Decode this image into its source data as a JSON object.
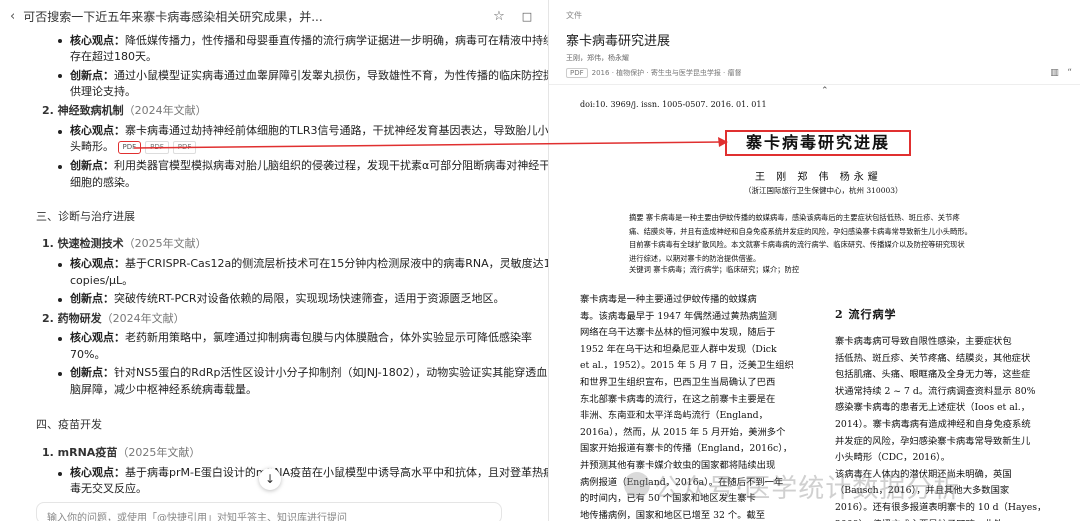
{
  "left": {
    "back_icon": "‹",
    "title": "可否搜索一下近五年来寨卡病毒感染相关研究成果，并...",
    "star_icon": "☆",
    "lock_icon": "🔒",
    "lines": {
      "l1a": "核心观点：",
      "l1b": "降低媒传播力，性传播和母婴垂直传播的流行病学证据进一步明确，病毒可在精液中持续",
      "l1c": "存在超过180天。",
      "l2a": "创新点：",
      "l2b": "通过小鼠模型证实病毒通过血睾屏障引发睾丸损伤，导致雄性不育，为性传播的临床防控提",
      "l2c": "供理论支持。",
      "s2": "2. 神经致病机制",
      "s2y": "（2024年文献）",
      "l3a": "核心观点：",
      "l3b": "寨卡病毒通过劫持神经前体细胞的TLR3信号通路，干扰神经发育基因表达，导致胎儿小",
      "l3c": "头畸形。",
      "l4a": "创新点：",
      "l4b": "利用类器官模型模拟病毒对胎儿脑组织的侵袭过程，发现干扰素α可部分阻断病毒对神经干",
      "l4c": "细胞的感染。",
      "h3": "三、诊断与治疗进展",
      "s3": "1. 快速检测技术",
      "s3y": "（2025年文献）",
      "l5a": "核心观点：",
      "l5b": "基于CRISPR-Cas12a的侧流层析技术可在15分钟内检测尿液中的病毒RNA，灵敏度达10",
      "l5c": "copies/μL。",
      "l6a": "创新点：",
      "l6b": "突破传统RT-PCR对设备依赖的局限，实现现场快速筛查，适用于资源匮乏地区。",
      "s4": "2. 药物研发",
      "s4y": "（2024年文献）",
      "l7a": "核心观点：",
      "l7b": "老药新用策略中，氯喹通过抑制病毒包膜与内体膜融合，体外实验显示可降低感染率",
      "l7c": "70%。",
      "l8a": "创新点：",
      "l8b": "针对NS5蛋白的RdRp活性区设计小分子抑制剂（如JNJ-1802），动物实验证实其能穿透血",
      "l8c": "脑屏障，减少中枢神经系统病毒载量。",
      "h4": "四、疫苗开发",
      "s5": "1. mRNA疫苗",
      "s5y": "（2025年文献）",
      "l9a": "核心观点：",
      "l9b": "基于病毒prM-E蛋白设计的mRNA疫苗在小鼠模型中诱导高水平中和抗体，且对登革热病",
      "l9c": "毒无交叉反应。"
    },
    "pdf_tags": [
      "PDF",
      "PDF",
      "PDF"
    ],
    "scroll_icon": "↓",
    "input_placeholder": "输入你的问题，或使用「@快捷引用」对知乎答主、知识库进行提问"
  },
  "right": {
    "file_label": "文件",
    "file_title": "寨卡病毒研究进展",
    "authors": "王刚，郑伟，杨永耀",
    "meta": {
      "tag": "PDF",
      "year": "2016",
      "journal": "· 植物保护 · 寄生虫与医学昆虫学报 · 瘤督"
    },
    "icons": [
      "▥",
      "“"
    ],
    "paper": {
      "doi": "doi:10. 3969/j. issn. 1005-0507. 2016. 01. 011",
      "title": "寨卡病毒研究进展",
      "authors": "王 刚 郑 伟 杨永耀",
      "affil": "（浙江国际旅行卫生保健中心，杭州 310003）",
      "abs1": "摘要  寨卡病毒是一种主要由伊蚊传播的蚊媒病毒，感染该病毒后的主要症状包括低热、斑丘疹、关节疼",
      "abs2": "痛、结膜炎等，并且有造成神经和自身免疫系统并发症的风险，孕妇感染寨卡病毒常导致新生儿小头畸形。",
      "abs3": "目前寨卡病毒有全球扩散风险。本文就寨卡病毒病的流行病学、临床研究、传播媒介以及防控等研究现状",
      "abs4": "进行综述，以期对寨卡的防治提供借鉴。",
      "keywords": "关键词  寨卡病毒；流行病学；临床研究；媒介；防控",
      "c1": [
        "寨卡病毒是一种主要通过伊蚊传播的蚊媒病",
        "毒。该病毒最早于 1947 年偶然通过黄热病监测",
        "网络在乌干达寨卡丛林的恒河猴中发现，随后于",
        "1952 年在乌干达和坦桑尼亚人群中发现（Dick",
        "et al.，1952）。2015 年 5 月 7 日，泛美卫生组织",
        "和世界卫生组织宣布，巴西卫生当局确认了巴西",
        "东北部寨卡病毒的流行，在这之前寨卡主要是在",
        "非洲、东南亚和太平洋岛屿流行（England，",
        "2016a），然而，从 2015 年 5 月开始，美洲多个",
        "国家开始报道有寨卡的传播（England，2016c），",
        "并预测其他有寨卡媒介蚊虫的国家都将陆续出现",
        "病例报道（England，2016a）。在随后不到一年",
        "的时间内，已有 50 个国家和地区发生寨卡",
        "地传播病例，国家和地区已增至 32 个。截至",
        "2016 年 3 月 11 日，全球已有 75 国累计人传病例"
      ],
      "h2": "2  流行病学",
      "c2": [
        "寨卡病毒病可导致自限性感染，主要症状包",
        "括低热、斑丘疹、关节疼痛、结膜炎，其他症状",
        "包括肌痛、头痛、眼眶痛及全身无力等，这些症",
        "状通常持续 2 ~ 7 d。流行病调查资料显示 80%",
        "感染寨卡病毒的患者无上述症状（Ioos et al.，",
        "2014）。寨卡病毒病有造成神经和自身免疫系统",
        "并发症的风险，孕妇感染寨卡病毒常导致新生儿",
        "小头畸形（CDC，2016）。",
        "该病毒在人体内的潜伏期还尚未明确，英国",
        "（Bausch，2016），并且其他大多数国家",
        "2016）。还有很多报道表明寨卡的 10 d（Hayes，",
        "2009），传播方式主要是蚊子叮咬，此外..."
      ]
    },
    "watermark": "公众号·医学统计数据分析"
  },
  "colors": {
    "highlight": "#e03030"
  }
}
